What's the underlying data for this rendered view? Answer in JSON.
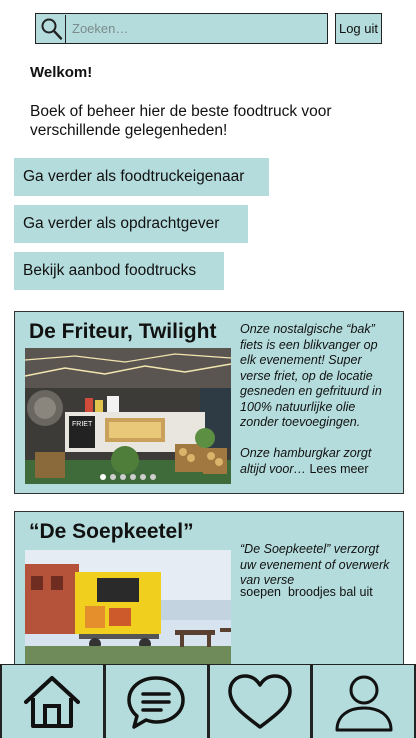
{
  "search": {
    "placeholder": "Zoeken…"
  },
  "header": {
    "logout_label": "Log uit"
  },
  "welcome": {
    "title": "Welkom!",
    "text": "Boek of beheer hier de beste foodtruck voor verschillende gelegenheden!"
  },
  "actions": [
    {
      "label": "Ga verder als foodtruckeigenaar"
    },
    {
      "label": "Ga verder als opdrachtgever"
    },
    {
      "label": "Bekijk aanbod foodtrucks"
    }
  ],
  "cards": [
    {
      "title": "De Friteur, Twilight",
      "description": "Onze nostalgische “bak” fiets is een blikvanger op elk evenement! Super verse friet, op de locatie gesneden en gefrituurd in 100% natuurlijke olie zonder toevoegingen.",
      "extra_italic": "Onze hamburgkar zorgt altijd voor…",
      "more_label": "Lees meer",
      "image_sign": "FRIET",
      "carousel_dots": 6
    },
    {
      "title": "“De Soepkeetel”",
      "description": "“De Soepkeetel” verzorgt uw evenement of overwerk van verse",
      "extra": "soepen  broodjes bal uit"
    }
  ],
  "bottom_nav": [
    {
      "icon": "home-icon"
    },
    {
      "icon": "chat-icon"
    },
    {
      "icon": "heart-icon"
    },
    {
      "icon": "profile-icon"
    }
  ],
  "colors": {
    "accent": "#b5dcdc",
    "border": "#222222"
  }
}
